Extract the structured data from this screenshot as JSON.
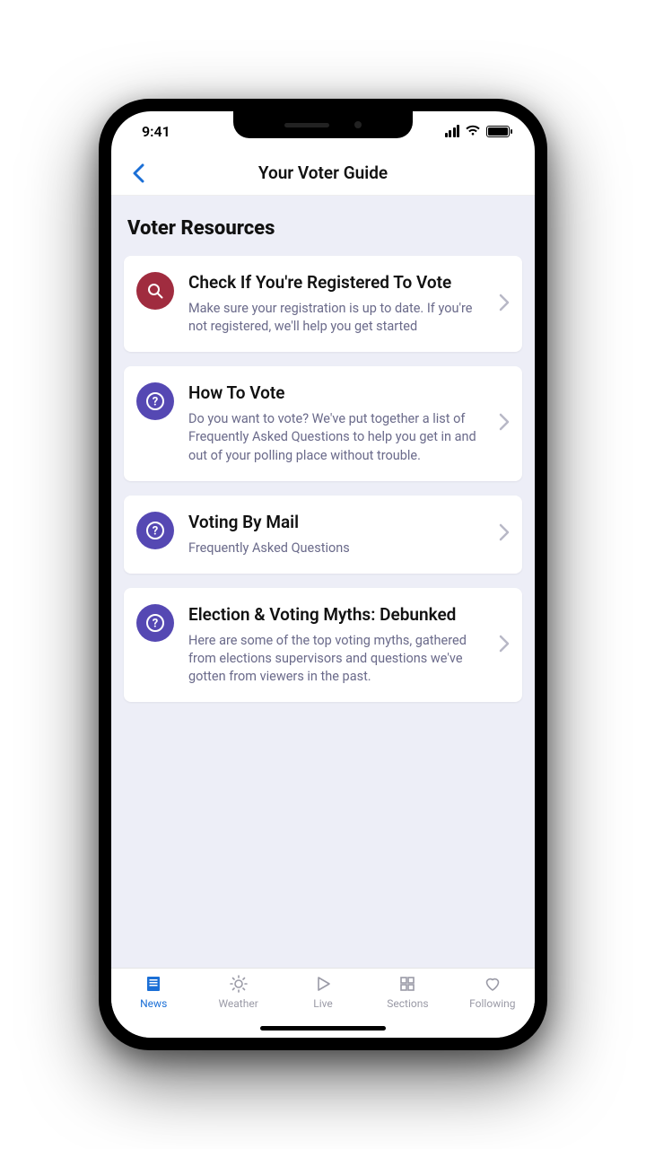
{
  "status": {
    "time": "9:41"
  },
  "header": {
    "title": "Your Voter Guide"
  },
  "section": {
    "title": "Voter Resources"
  },
  "cards": [
    {
      "icon": "search-icon",
      "icon_color": "maroon",
      "title": "Check If You're Registered To Vote",
      "desc": "Make sure your registration is up to date. If you're not registered, we'll help you get started"
    },
    {
      "icon": "question-icon",
      "icon_color": "purple",
      "title": "How To Vote",
      "desc": "Do you want to vote? We've put together a list of Frequently Asked Questions to help you get in and out of your polling place without trouble."
    },
    {
      "icon": "question-icon",
      "icon_color": "purple",
      "title": "Voting By Mail",
      "desc": "Frequently Asked Questions"
    },
    {
      "icon": "question-icon",
      "icon_color": "purple",
      "title": "Election & Voting Myths: Debunked",
      "desc": "Here are some of the top voting myths, gathered from elections supervisors and questions we've gotten from viewers in the past."
    }
  ],
  "tabs": [
    {
      "label": "News",
      "icon": "news-icon",
      "active": true
    },
    {
      "label": "Weather",
      "icon": "weather-icon",
      "active": false
    },
    {
      "label": "Live",
      "icon": "live-icon",
      "active": false
    },
    {
      "label": "Sections",
      "icon": "sections-icon",
      "active": false
    },
    {
      "label": "Following",
      "icon": "following-icon",
      "active": false
    }
  ],
  "colors": {
    "accent_blue": "#1b6fd6",
    "content_bg": "#edeef7",
    "icon_maroon": "#a02c3f",
    "icon_purple": "#5548b3",
    "desc_text": "#6a6a8a"
  }
}
